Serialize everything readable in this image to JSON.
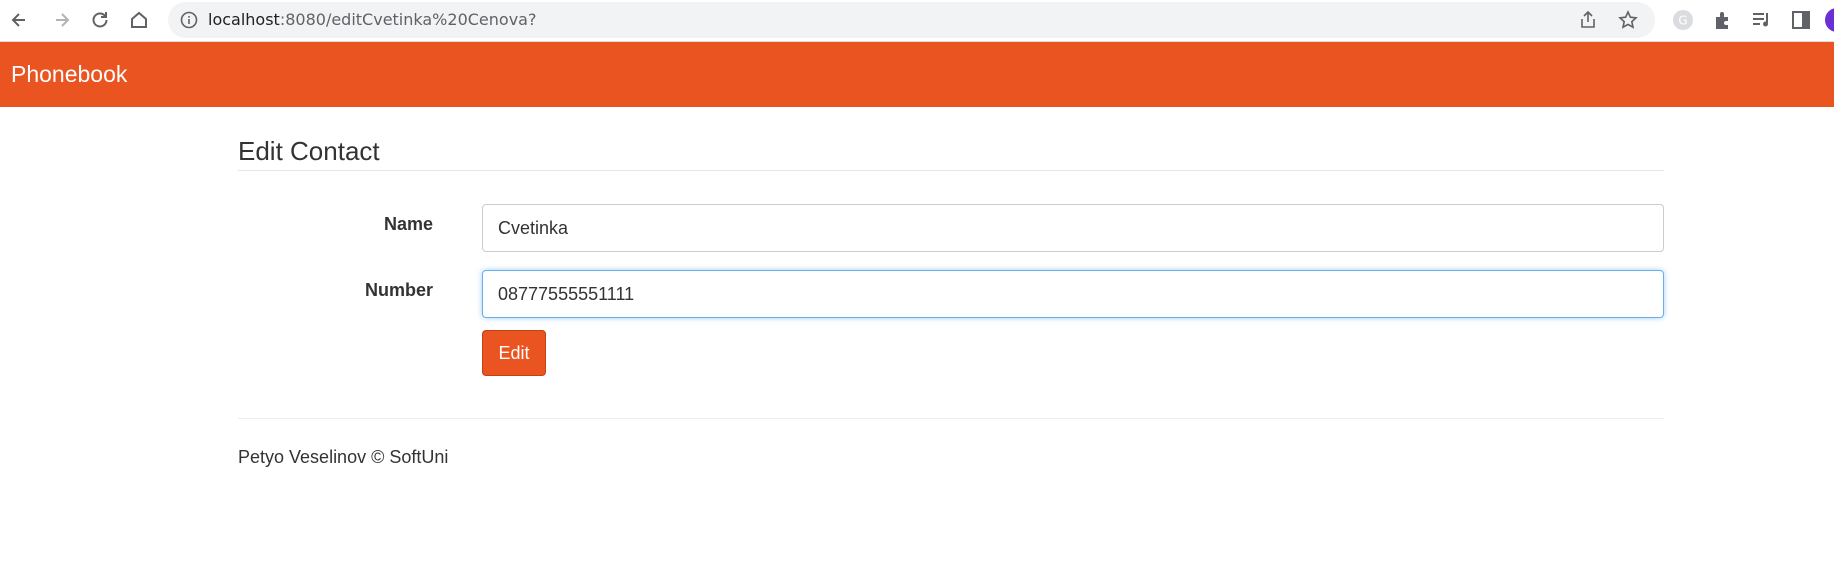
{
  "browser": {
    "url_host": "localhost",
    "url_rest": ":8080/editCvetinka%20Cenova?",
    "icons": [
      "back-icon",
      "forward-icon",
      "reload-icon",
      "home-icon",
      "info-icon",
      "share-icon",
      "star-icon",
      "grammarly-icon",
      "extensions-icon",
      "media-icon",
      "side-panel-icon",
      "profile-icon"
    ]
  },
  "navbar": {
    "brand": "Phonebook",
    "color": "#e95420"
  },
  "form": {
    "legend": "Edit Contact",
    "name_label": "Name",
    "name_value": "Cvetinka",
    "number_label": "Number",
    "number_value": "08777555551111",
    "submit_label": "Edit"
  },
  "footer": {
    "text": "Petyo Veselinov © SoftUni"
  }
}
